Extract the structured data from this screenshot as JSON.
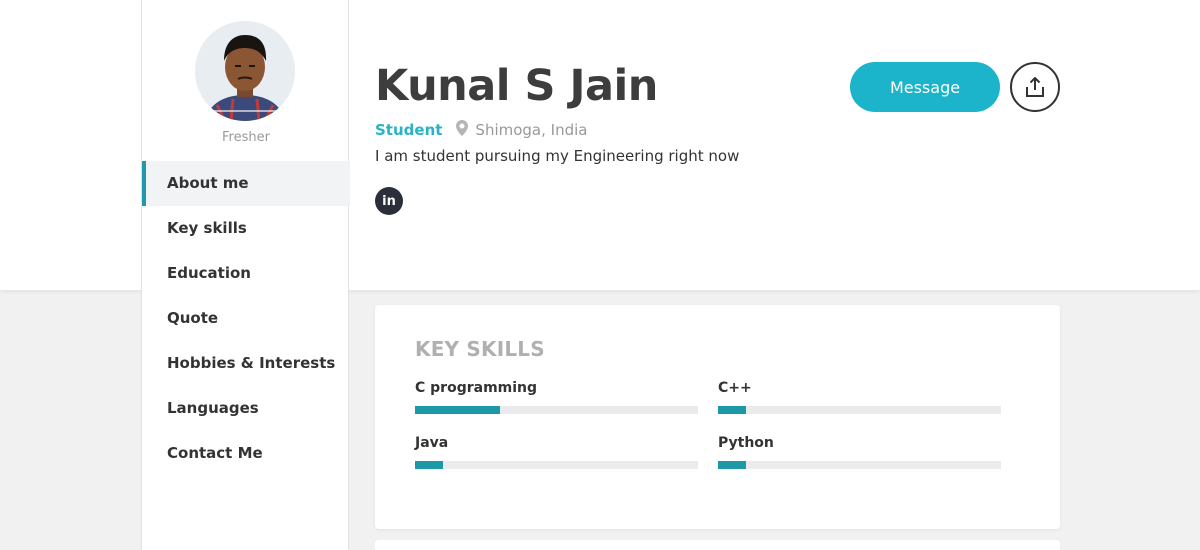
{
  "sidebar": {
    "experience_label": "Fresher",
    "nav": [
      {
        "label": "About me",
        "active": true
      },
      {
        "label": "Key skills"
      },
      {
        "label": "Education"
      },
      {
        "label": "Quote"
      },
      {
        "label": "Hobbies & Interests"
      },
      {
        "label": "Languages"
      },
      {
        "label": "Contact Me"
      }
    ]
  },
  "profile": {
    "name": "Kunal S Jain",
    "role": "Student",
    "location": "Shimoga, India",
    "bio": "I am student pursuing my Engineering right now",
    "linkedin_label": "in"
  },
  "actions": {
    "message_label": "Message"
  },
  "key_skills": {
    "title": "KEY SKILLS",
    "skills": [
      {
        "name": "C programming",
        "level": 0.3
      },
      {
        "name": "C++",
        "level": 0.1
      },
      {
        "name": "Java",
        "level": 0.1
      },
      {
        "name": "Python",
        "level": 0.1
      }
    ]
  },
  "colors": {
    "accent": "#1cb4ca",
    "bar_fill": "#1c98a6",
    "role_text": "#2ab3c6"
  },
  "icons": [
    "location-pin-icon",
    "share-icon",
    "linkedin-icon"
  ]
}
